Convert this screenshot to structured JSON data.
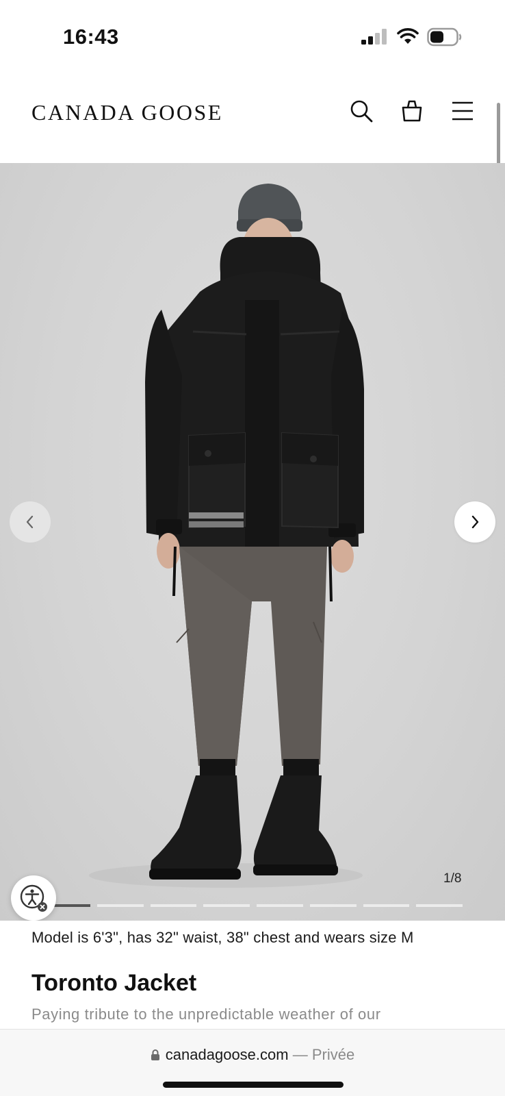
{
  "status_bar": {
    "time": "16:43",
    "icons": [
      "signal-icon",
      "wifi-icon",
      "battery-icon"
    ]
  },
  "header": {
    "brand": "CANADA GOOSE",
    "icons": [
      "search-icon",
      "cart-icon",
      "menu-icon"
    ]
  },
  "gallery": {
    "counter": "1/8",
    "current_slide": 1,
    "total_slides": 8,
    "prev_icon": "chevron-left-icon",
    "next_icon": "chevron-right-icon",
    "accessibility_icon": "accessibility-icon"
  },
  "product": {
    "model_info": "Model is 6'3\", has 32\" waist, 38\" chest and wears size M",
    "title": "Toronto Jacket",
    "description": "Paying tribute to the unpredictable weather of our"
  },
  "browser": {
    "domain": "canadagoose.com",
    "separator": "—",
    "privacy": "Privée"
  },
  "colors": {
    "background": "#ffffff",
    "gallery_bg": "#d6d6d6",
    "text": "#111111",
    "muted_text": "#8a8a8a",
    "progress_active": "#555555"
  }
}
